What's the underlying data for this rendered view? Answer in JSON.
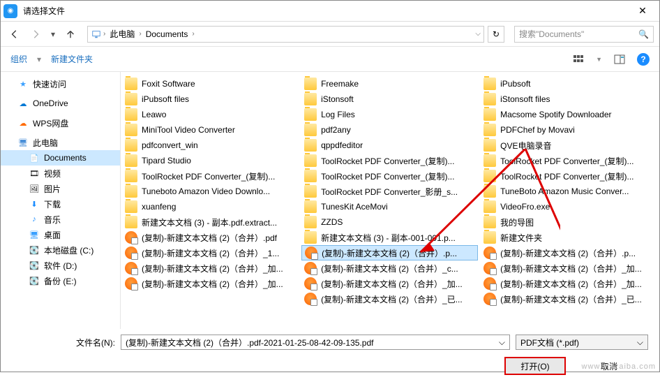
{
  "title": "请选择文件",
  "breadcrumb": {
    "root": "此电脑",
    "folder": "Documents"
  },
  "search_placeholder": "搜索\"Documents\"",
  "toolbar": {
    "organize": "组织",
    "newfolder": "新建文件夹"
  },
  "sidebar": {
    "quick": "快速访问",
    "onedrive": "OneDrive",
    "wps": "WPS网盘",
    "thispc": "此电脑",
    "documents": "Documents",
    "video": "视频",
    "pictures": "图片",
    "downloads": "下载",
    "music": "音乐",
    "desktop": "桌面",
    "disk_c": "本地磁盘 (C:)",
    "disk_d": "软件 (D:)",
    "disk_e": "备份 (E:)"
  },
  "cols": [
    [
      {
        "t": "folder",
        "n": "Foxit Software"
      },
      {
        "t": "folder",
        "n": "iPubsoft files"
      },
      {
        "t": "folder",
        "n": "Leawo"
      },
      {
        "t": "folder",
        "n": "MiniTool Video Converter"
      },
      {
        "t": "folder",
        "n": "pdfconvert_win"
      },
      {
        "t": "folder",
        "n": "Tipard Studio"
      },
      {
        "t": "folder",
        "n": "ToolRocket PDF Converter_(复制)..."
      },
      {
        "t": "folder",
        "n": "Tuneboto Amazon Video Downlo..."
      },
      {
        "t": "folder",
        "n": "xuanfeng"
      },
      {
        "t": "folder",
        "n": "新建文本文档 (3) - 副本.pdf.extract..."
      },
      {
        "t": "pdf",
        "n": "(复制)-新建文本文档 (2)（合并）.pdf"
      },
      {
        "t": "pdf",
        "n": "(复制)-新建文本文档 (2)（合并）_1..."
      },
      {
        "t": "pdf",
        "n": "(复制)-新建文本文档 (2)（合并）_加..."
      },
      {
        "t": "pdf",
        "n": "(复制)-新建文本文档 (2)（合并）_加..."
      }
    ],
    [
      {
        "t": "folder",
        "n": "Freemake"
      },
      {
        "t": "folder",
        "n": "iStonsoft"
      },
      {
        "t": "folder",
        "n": "Log Files"
      },
      {
        "t": "folder",
        "n": "pdf2any"
      },
      {
        "t": "folder",
        "n": "qppdfeditor"
      },
      {
        "t": "folder",
        "n": "ToolRocket PDF Converter_(复制)..."
      },
      {
        "t": "folder",
        "n": "ToolRocket PDF Converter_(复制)..."
      },
      {
        "t": "folder",
        "n": "ToolRocket PDF Converter_影册_s..."
      },
      {
        "t": "folder",
        "n": "TunesKit AceMovi"
      },
      {
        "t": "folder",
        "n": "ZZDS"
      },
      {
        "t": "folder",
        "n": "新建文本文档 (3) - 副本-001-001.p..."
      },
      {
        "t": "pdf",
        "n": "(复制)-新建文本文档 (2)（合并）.p...",
        "sel": true
      },
      {
        "t": "pdf",
        "n": "(复制)-新建文本文档 (2)（合并）_c..."
      },
      {
        "t": "pdf",
        "n": "(复制)-新建文本文档 (2)（合并）_加..."
      },
      {
        "t": "pdf",
        "n": "(复制)-新建文本文档 (2)（合并）_已..."
      }
    ],
    [
      {
        "t": "folder",
        "n": "iPubsoft"
      },
      {
        "t": "folder",
        "n": "iStonsoft files"
      },
      {
        "t": "folder",
        "n": "Macsome Spotify Downloader"
      },
      {
        "t": "folder",
        "n": "PDFChef by Movavi"
      },
      {
        "t": "folder",
        "n": "QVE电脑录音"
      },
      {
        "t": "folder",
        "n": "ToolRocket PDF Converter_(复制)..."
      },
      {
        "t": "folder",
        "n": "ToolRocket PDF Converter_(复制)..."
      },
      {
        "t": "folder",
        "n": "TuneBoto Amazon Music Conver..."
      },
      {
        "t": "folder",
        "n": "VideoFro.exe"
      },
      {
        "t": "folder",
        "n": "我的导图"
      },
      {
        "t": "folder",
        "n": "新建文件夹"
      },
      {
        "t": "pdf",
        "n": "(复制)-新建文本文档 (2)（合并）.p..."
      },
      {
        "t": "pdf",
        "n": "(复制)-新建文本文档 (2)（合并）_加..."
      },
      {
        "t": "pdf",
        "n": "(复制)-新建文本文档 (2)（合并）_加..."
      },
      {
        "t": "pdf",
        "n": "(复制)-新建文本文档 (2)（合并）_已..."
      }
    ]
  ],
  "filename_label": "文件名(N):",
  "filename_value": "(复制)-新建文本文档 (2)（合并）.pdf-2021-01-25-08-42-09-135.pdf",
  "filter": "PDF文档 (*.pdf)",
  "open_btn": "打开(O)",
  "cancel_btn": "取消",
  "watermark": "www.xiazaiba.com"
}
